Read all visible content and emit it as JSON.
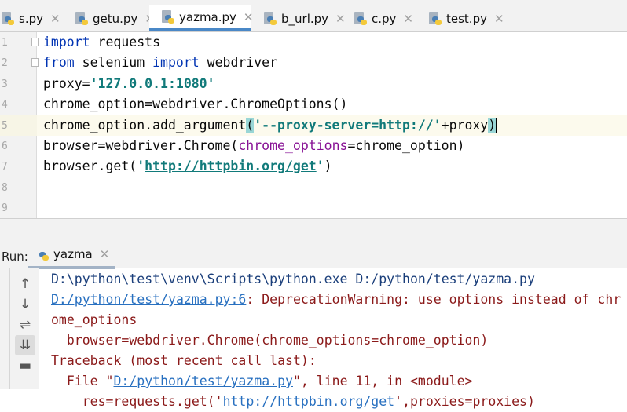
{
  "tabs": [
    {
      "label": "s.py",
      "active": false
    },
    {
      "label": "getu.py",
      "active": false
    },
    {
      "label": "yazma.py",
      "active": true
    },
    {
      "label": "b_url.py",
      "active": false
    },
    {
      "label": "c.py",
      "active": false
    },
    {
      "label": "test.py",
      "active": false
    }
  ],
  "close_glyph": "✕",
  "gutter": {
    "line_numbers": [
      "1",
      "2",
      "3",
      "4",
      "5",
      "6",
      "7",
      "8",
      "9"
    ]
  },
  "code_lines": [
    [
      {
        "t": "import",
        "c": "kw"
      },
      {
        "t": " requests",
        "c": "plain"
      }
    ],
    [
      {
        "t": "from",
        "c": "kw"
      },
      {
        "t": " selenium ",
        "c": "plain"
      },
      {
        "t": "import",
        "c": "kw"
      },
      {
        "t": " webdriver",
        "c": "plain"
      }
    ],
    [
      {
        "t": "proxy=",
        "c": "plain"
      },
      {
        "t": "'127.0.0.1:1080'",
        "c": "strb"
      }
    ],
    [
      {
        "t": "chrome_option=webdriver.ChromeOptions()",
        "c": "plain"
      }
    ],
    [
      {
        "t": "chrome_option.add_argument",
        "c": "plain"
      },
      {
        "t": "(",
        "c": "plain brace"
      },
      {
        "t": "'--proxy-server=http://'",
        "c": "strb"
      },
      {
        "t": "+proxy",
        "c": "plain"
      },
      {
        "t": ")",
        "c": "plain brace"
      }
    ],
    [
      {
        "t": "browser=webdriver.Chrome(",
        "c": "plain"
      },
      {
        "t": "chrome_options",
        "c": "param"
      },
      {
        "t": "=chrome_option)",
        "c": "plain"
      }
    ],
    [
      {
        "t": "browser.get(",
        "c": "plain"
      },
      {
        "t": "'",
        "c": "strb"
      },
      {
        "t": "http://httpbin.org/get",
        "c": "url"
      },
      {
        "t": "'",
        "c": "strb"
      },
      {
        "t": ")",
        "c": "plain"
      }
    ]
  ],
  "run": {
    "label": "Run:",
    "tab": "yazma"
  },
  "console_lines": [
    [
      {
        "t": "D:\\python\\test\\venv\\Scripts\\python.exe D:/python/test/yazma.py",
        "c": "cblue"
      }
    ],
    [
      {
        "t": "D:/python/test/yazma.py:6",
        "c": "clink"
      },
      {
        "t": ": DeprecationWarning: use options instead of chrome_options",
        "c": "cred"
      }
    ],
    [
      {
        "t": "  browser=webdriver.Chrome(chrome_options=chrome_option)",
        "c": "cred"
      }
    ],
    [
      {
        "t": "Traceback (most recent call last):",
        "c": "cred"
      }
    ],
    [
      {
        "t": "  File \"",
        "c": "cred"
      },
      {
        "t": "D:/python/test/yazma.py",
        "c": "clink"
      },
      {
        "t": "\", line 11, in <module>",
        "c": "cred"
      }
    ],
    [
      {
        "t": "    res=requests.get('",
        "c": "cred"
      },
      {
        "t": "http://httpbin.org/get",
        "c": "clink"
      },
      {
        "t": "',proxies=proxies)",
        "c": "cred"
      }
    ]
  ],
  "tools": [
    "arrow-up-icon",
    "arrow-down-icon",
    "soft-wrap-icon",
    "scroll-to-end-icon",
    "print-icon"
  ],
  "colors": {
    "active_tab_underline": "#4a88c7",
    "keyword": "#0033b3",
    "string": "#117a7a",
    "error": "#8b1a1a",
    "link": "#2870c0"
  }
}
